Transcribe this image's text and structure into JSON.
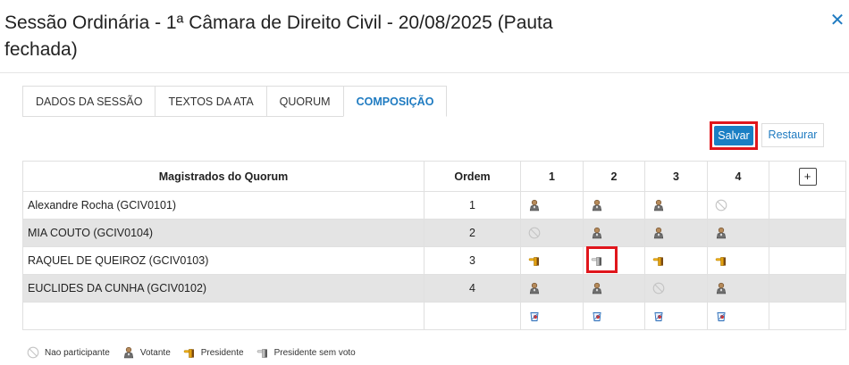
{
  "header": {
    "title": "Sessão Ordinária - 1ª Câmara de Direito Civil - 20/08/2025 (Pauta fechada)",
    "close_glyph": "✕"
  },
  "tabs": [
    {
      "label": "DADOS DA SESSÃO",
      "active": false
    },
    {
      "label": "TEXTOS DA ATA",
      "active": false
    },
    {
      "label": "QUORUM",
      "active": false
    },
    {
      "label": "COMPOSIÇÃO",
      "active": true
    }
  ],
  "toolbar": {
    "save_label": "Salvar",
    "restore_label": "Restaurar"
  },
  "table": {
    "headers": {
      "name": "Magistrados do Quorum",
      "order": "Ordem",
      "cols": [
        "1",
        "2",
        "3",
        "4"
      ],
      "add": "+"
    },
    "rows": [
      {
        "name": "Alexandre Rocha (GCIV0101)",
        "order": "1",
        "cells": [
          "votante",
          "votante",
          "votante",
          "nao-participante"
        ]
      },
      {
        "name": "MIA COUTO (GCIV0104)",
        "order": "2",
        "cells": [
          "nao-participante",
          "votante",
          "votante",
          "votante"
        ]
      },
      {
        "name": "RAQUEL DE QUEIROZ (GCIV0103)",
        "order": "3",
        "cells": [
          "presidente",
          "presidente-sem-voto",
          "presidente",
          "presidente"
        ]
      },
      {
        "name": "EUCLIDES DA CUNHA (GCIV0102)",
        "order": "4",
        "cells": [
          "votante",
          "votante",
          "nao-participante",
          "votante"
        ]
      }
    ],
    "footer_cells": [
      "clear-icon",
      "clear-icon",
      "clear-icon",
      "clear-icon"
    ]
  },
  "legend": [
    {
      "icon": "nao-participante",
      "label": "Nao participante"
    },
    {
      "icon": "votante",
      "label": "Votante"
    },
    {
      "icon": "presidente",
      "label": "Presidente"
    },
    {
      "icon": "presidente-sem-voto",
      "label": "Presidente sem voto"
    }
  ],
  "colors": {
    "accent": "#1f7bc1",
    "save_bg": "#1a7fc4",
    "highlight": "#e0161c",
    "row_alt": "#e4e4e4"
  }
}
